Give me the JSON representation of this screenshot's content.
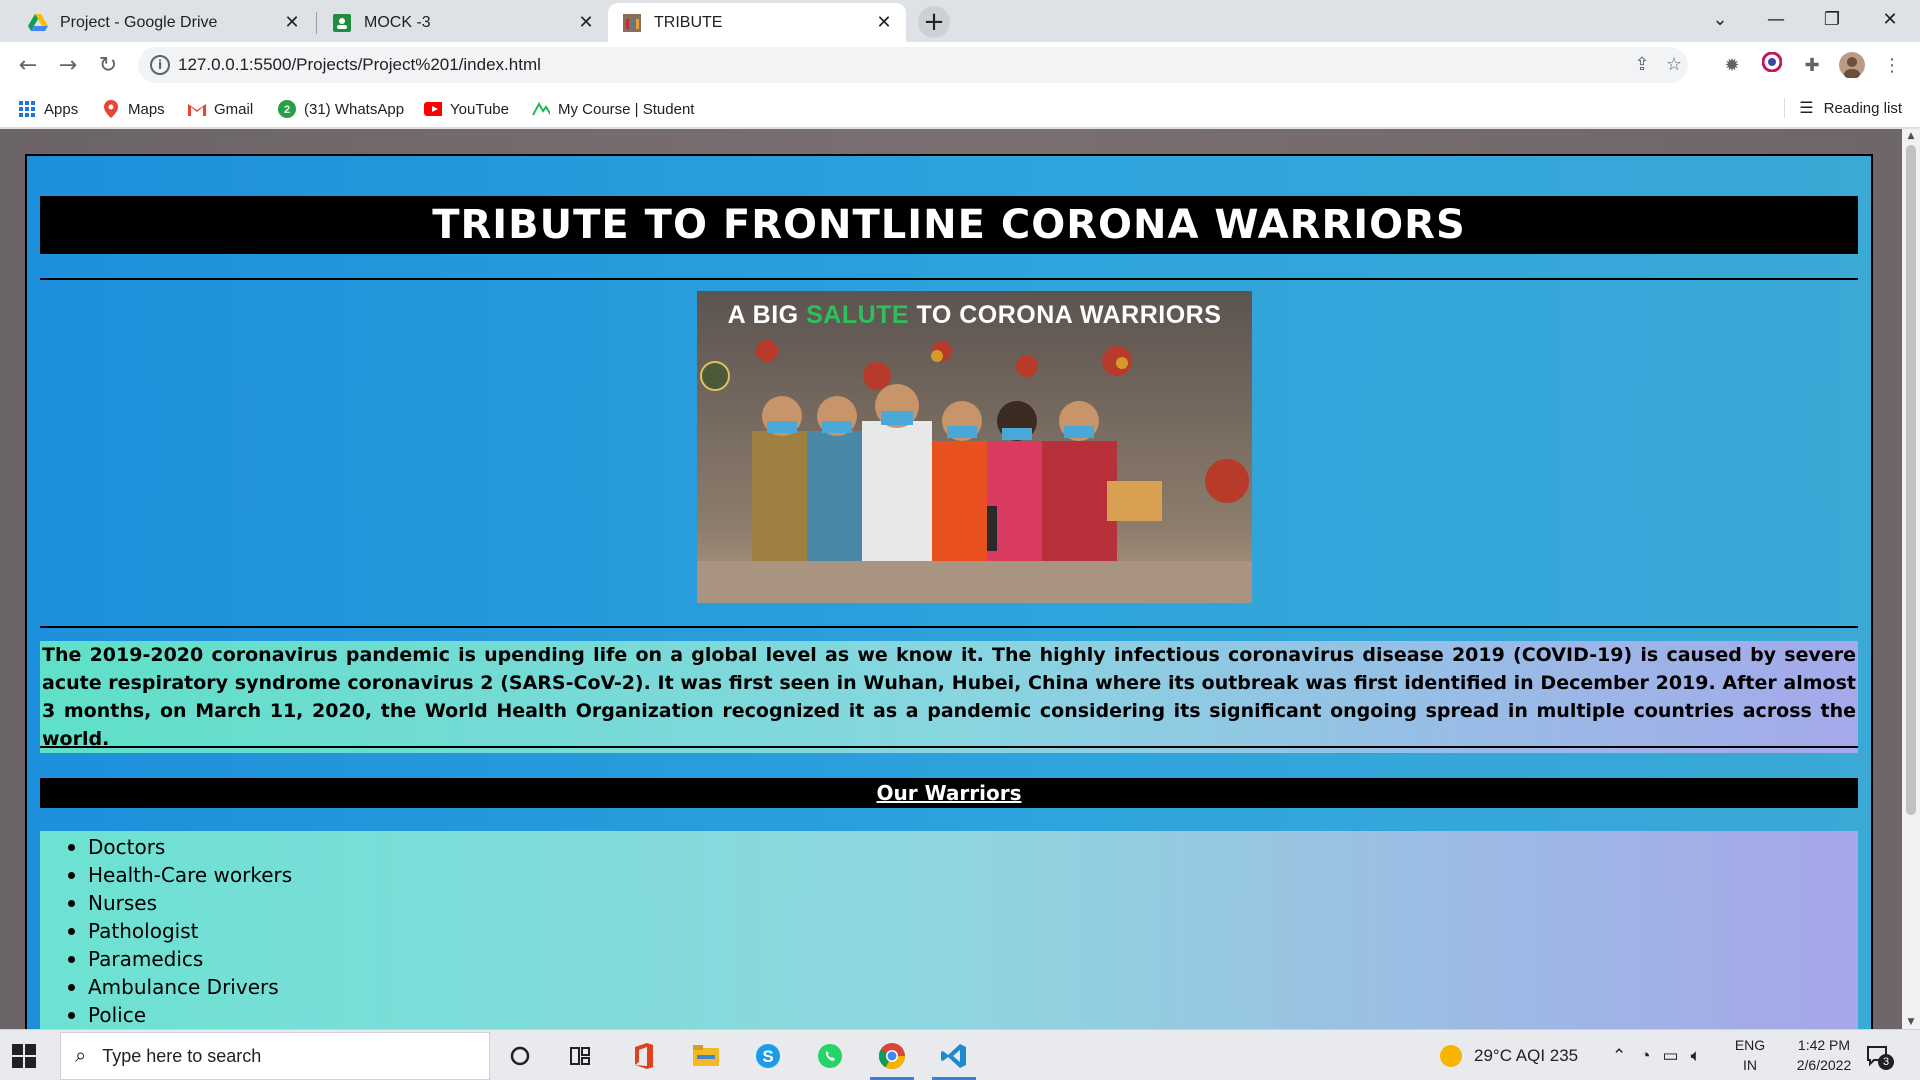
{
  "browser": {
    "tabs": [
      {
        "title": "Project - Google Drive",
        "active": false
      },
      {
        "title": "MOCK -3",
        "active": false
      },
      {
        "title": "TRIBUTE",
        "active": true
      }
    ],
    "new_tab": "+",
    "url": "127.0.0.1:5500/Projects/Project%201/index.html",
    "bookmarks": [
      {
        "label": "Apps"
      },
      {
        "label": "Maps"
      },
      {
        "label": "Gmail"
      },
      {
        "label": "(31) WhatsApp"
      },
      {
        "label": "YouTube"
      },
      {
        "label": "My Course | Student"
      }
    ],
    "reading_list": "Reading list"
  },
  "page": {
    "title": "TRIBUTE TO FRONTLINE CORONA WARRIORS",
    "hero": {
      "headline_a": "A BIG",
      "headline_b": "SALUTE",
      "headline_c": "TO CORONA WARRIORS"
    },
    "intro": "The 2019-2020 coronavirus pandemic is upending life on a global level as we know it. The highly infectious coronavirus disease 2019 (COVID-19) is caused by severe acute respiratory syndrome coronavirus 2 (SARS-CoV-2). It was first seen in Wuhan, Hubei, China where its outbreak was first identified in December 2019. After almost 3 months, on March 11, 2020, the World Health Organization recognized it as a pandemic considering its significant ongoing spread in multiple countries across the world.",
    "subheading": "Our Warriors",
    "warriors": [
      "Doctors",
      "Health-Care workers",
      "Nurses",
      "Pathologist",
      "Paramedics",
      "Ambulance Drivers",
      "Police"
    ]
  },
  "taskbar": {
    "search_placeholder": "Type here to search",
    "weather": "29°C  AQI 235",
    "lang_top": "ENG",
    "lang_bottom": "IN",
    "time": "1:42 PM",
    "date": "2/6/2022",
    "notifications": "3"
  },
  "colors": {
    "page_gradient_start": "#1e8fdc",
    "page_gradient_end": "#3aa9d6",
    "banner_bg": "#000000",
    "salute_green": "#2ec05a"
  }
}
